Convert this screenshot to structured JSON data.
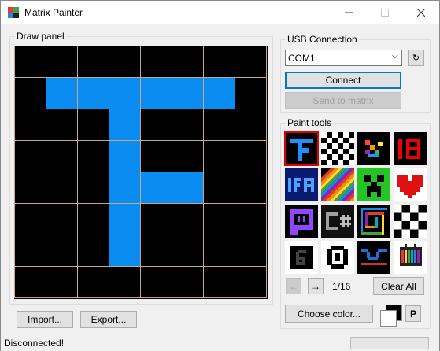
{
  "window": {
    "title": "Matrix Painter"
  },
  "draw_panel": {
    "legend": "Draw panel",
    "colors": {
      "off": "#000000",
      "on": "#0a8cf0",
      "grid": "#c8a68a"
    },
    "pattern": [
      "00000000",
      "01111110",
      "00010000",
      "00010000",
      "00011100",
      "00010000",
      "00010000",
      "00000000"
    ]
  },
  "buttons": {
    "import": "Import...",
    "export": "Export...",
    "connect": "Connect",
    "send": "Send to matrix",
    "clear_all": "Clear All",
    "choose_color": "Choose color...",
    "p": "P",
    "refresh": "↻",
    "prev": "←",
    "next": "→"
  },
  "usb": {
    "legend": "USB Connection",
    "port": "COM1"
  },
  "paint_tools": {
    "legend": "Paint tools",
    "page": "1/16",
    "tiles": [
      "tool-letter-f",
      "tool-checker-pattern",
      "tool-colored-glyph",
      "tool-number-18",
      "tool-ifa-text",
      "tool-rainbow-stripes",
      "tool-creeper-face",
      "tool-heart",
      "tool-twitch-logo",
      "tool-csharp-logo",
      "tool-spiral",
      "tool-checker-large",
      "tool-number-6",
      "tool-ring-pattern",
      "tool-wave",
      "tool-tv-test"
    ]
  },
  "status": {
    "text": "Disconnected!"
  }
}
